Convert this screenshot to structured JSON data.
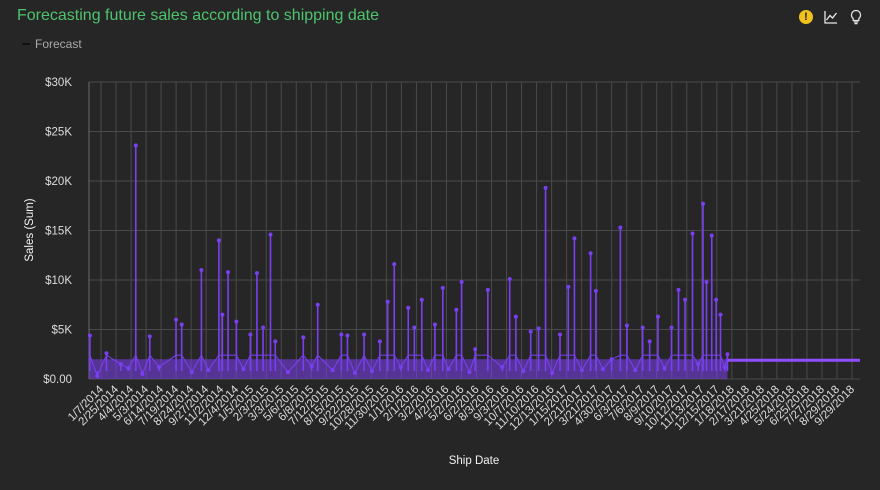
{
  "header": {
    "title": "Forecasting future sales according to shipping date",
    "legend_label": "Forecast"
  },
  "toolbar": {
    "icons": [
      "warning-icon",
      "line-chart-icon",
      "lightbulb-icon"
    ],
    "warning_color": "#f1c21b"
  },
  "colors": {
    "series": "#7b3ff2",
    "forecast": "#8e4dff",
    "title": "#4ec36e",
    "grid": "#4a4a4a"
  },
  "chart_data": {
    "type": "line",
    "xlabel": "Ship Date",
    "ylabel": "Sales (Sum)",
    "ylim": [
      0,
      30000
    ],
    "yticks": [
      0,
      5000,
      10000,
      15000,
      20000,
      25000,
      30000
    ],
    "ytick_labels": [
      "$0.00",
      "$5K",
      "$10K",
      "$15K",
      "$20K",
      "$25K",
      "$30K"
    ],
    "x_range": [
      "1/1/2014",
      "10/30/2018"
    ],
    "xtick_labels": [
      "1/7/2014",
      "2/25/2014",
      "4/4/2014",
      "5/3/2014",
      "6/14/2014",
      "7/19/2014",
      "8/24/2014",
      "9/27/2014",
      "11/2/2014",
      "12/4/2014",
      "1/5/2015",
      "2/3/2015",
      "3/3/2015",
      "5/6/2015",
      "6/8/2015",
      "7/12/2015",
      "8/15/2015",
      "9/22/2015",
      "10/28/2015",
      "11/30/2015",
      "1/1/2016",
      "2/1/2016",
      "3/2/2016",
      "4/2/2016",
      "5/2/2016",
      "6/2/2016",
      "8/3/2016",
      "9/3/2016",
      "10/7/2016",
      "11/10/2016",
      "12/13/2016",
      "1/15/2017",
      "2/21/2017",
      "3/21/2017",
      "4/30/2017",
      "6/3/2017",
      "7/6/2017",
      "8/9/2017",
      "9/10/2017",
      "10/12/2017",
      "11/13/2017",
      "12/15/2017",
      "1/18/2018",
      "2/17/2018",
      "3/21/2018",
      "4/25/2018",
      "5/24/2018",
      "6/25/2018",
      "7/27/2018",
      "8/29/2018",
      "9/29/2018"
    ],
    "series": [
      {
        "values": [
          {
            "x": "1/3/2014",
            "y": 4400
          },
          {
            "x": "1/20/2014",
            "y": 300
          },
          {
            "x": "2/10/2014",
            "y": 2600
          },
          {
            "x": "3/15/2014",
            "y": 1500
          },
          {
            "x": "4/1/2014",
            "y": 1100
          },
          {
            "x": "4/18/2014",
            "y": 23600
          },
          {
            "x": "5/3/2014",
            "y": 500
          },
          {
            "x": "5/20/2014",
            "y": 4300
          },
          {
            "x": "6/10/2014",
            "y": 1200
          },
          {
            "x": "7/19/2014",
            "y": 6000
          },
          {
            "x": "8/1/2014",
            "y": 5500
          },
          {
            "x": "8/24/2014",
            "y": 700
          },
          {
            "x": "9/15/2014",
            "y": 11000
          },
          {
            "x": "10/1/2014",
            "y": 900
          },
          {
            "x": "10/25/2014",
            "y": 14000
          },
          {
            "x": "11/2/2014",
            "y": 6500
          },
          {
            "x": "11/15/2014",
            "y": 10800
          },
          {
            "x": "12/4/2014",
            "y": 5800
          },
          {
            "x": "12/20/2014",
            "y": 1000
          },
          {
            "x": "1/5/2015",
            "y": 4500
          },
          {
            "x": "1/20/2015",
            "y": 10700
          },
          {
            "x": "2/3/2015",
            "y": 5200
          },
          {
            "x": "2/20/2015",
            "y": 14600
          },
          {
            "x": "3/3/2015",
            "y": 3800
          },
          {
            "x": "4/1/2015",
            "y": 700
          },
          {
            "x": "5/6/2015",
            "y": 4200
          },
          {
            "x": "5/25/2015",
            "y": 1300
          },
          {
            "x": "6/8/2015",
            "y": 7500
          },
          {
            "x": "7/12/2015",
            "y": 900
          },
          {
            "x": "8/1/2015",
            "y": 4500
          },
          {
            "x": "8/15/2015",
            "y": 4400
          },
          {
            "x": "9/1/2015",
            "y": 600
          },
          {
            "x": "9/22/2015",
            "y": 4500
          },
          {
            "x": "10/10/2015",
            "y": 800
          },
          {
            "x": "10/28/2015",
            "y": 3800
          },
          {
            "x": "11/15/2015",
            "y": 7800
          },
          {
            "x": "11/30/2015",
            "y": 11600
          },
          {
            "x": "12/15/2015",
            "y": 1200
          },
          {
            "x": "1/1/2016",
            "y": 7200
          },
          {
            "x": "1/15/2016",
            "y": 5200
          },
          {
            "x": "2/1/2016",
            "y": 8000
          },
          {
            "x": "2/15/2016",
            "y": 900
          },
          {
            "x": "3/2/2016",
            "y": 5500
          },
          {
            "x": "3/20/2016",
            "y": 9200
          },
          {
            "x": "4/2/2016",
            "y": 1000
          },
          {
            "x": "4/20/2016",
            "y": 7000
          },
          {
            "x": "5/2/2016",
            "y": 9800
          },
          {
            "x": "5/20/2016",
            "y": 700
          },
          {
            "x": "6/2/2016",
            "y": 3000
          },
          {
            "x": "7/1/2016",
            "y": 9000
          },
          {
            "x": "8/3/2016",
            "y": 1200
          },
          {
            "x": "8/20/2016",
            "y": 10100
          },
          {
            "x": "9/3/2016",
            "y": 6300
          },
          {
            "x": "9/20/2016",
            "y": 800
          },
          {
            "x": "10/7/2016",
            "y": 4800
          },
          {
            "x": "10/25/2016",
            "y": 5100
          },
          {
            "x": "11/10/2016",
            "y": 19300
          },
          {
            "x": "11/25/2016",
            "y": 600
          },
          {
            "x": "12/13/2016",
            "y": 4500
          },
          {
            "x": "1/1/2017",
            "y": 9300
          },
          {
            "x": "1/15/2017",
            "y": 14200
          },
          {
            "x": "2/1/2017",
            "y": 900
          },
          {
            "x": "2/21/2017",
            "y": 12700
          },
          {
            "x": "3/5/2017",
            "y": 8900
          },
          {
            "x": "3/21/2017",
            "y": 1000
          },
          {
            "x": "4/10/2017",
            "y": 2000
          },
          {
            "x": "4/30/2017",
            "y": 15300
          },
          {
            "x": "5/15/2017",
            "y": 5400
          },
          {
            "x": "6/3/2017",
            "y": 900
          },
          {
            "x": "6/20/2017",
            "y": 5200
          },
          {
            "x": "7/6/2017",
            "y": 3800
          },
          {
            "x": "7/25/2017",
            "y": 6300
          },
          {
            "x": "8/9/2017",
            "y": 1100
          },
          {
            "x": "8/25/2017",
            "y": 5200
          },
          {
            "x": "9/10/2017",
            "y": 9000
          },
          {
            "x": "9/25/2017",
            "y": 8000
          },
          {
            "x": "10/12/2017",
            "y": 14700
          },
          {
            "x": "10/25/2017",
            "y": 1500
          },
          {
            "x": "11/5/2017",
            "y": 17700
          },
          {
            "x": "11/13/2017",
            "y": 9800
          },
          {
            "x": "11/25/2017",
            "y": 14500
          },
          {
            "x": "12/5/2017",
            "y": 8000
          },
          {
            "x": "12/15/2017",
            "y": 6500
          },
          {
            "x": "12/25/2017",
            "y": 1200
          },
          {
            "x": "12/31/2017",
            "y": 2500
          }
        ]
      },
      {
        "values": [
          {
            "x": "1/1/2018",
            "y": 1900
          },
          {
            "x": "10/30/2018",
            "y": 1900
          }
        ]
      }
    ],
    "grid": true,
    "legend_position": "top-left"
  }
}
